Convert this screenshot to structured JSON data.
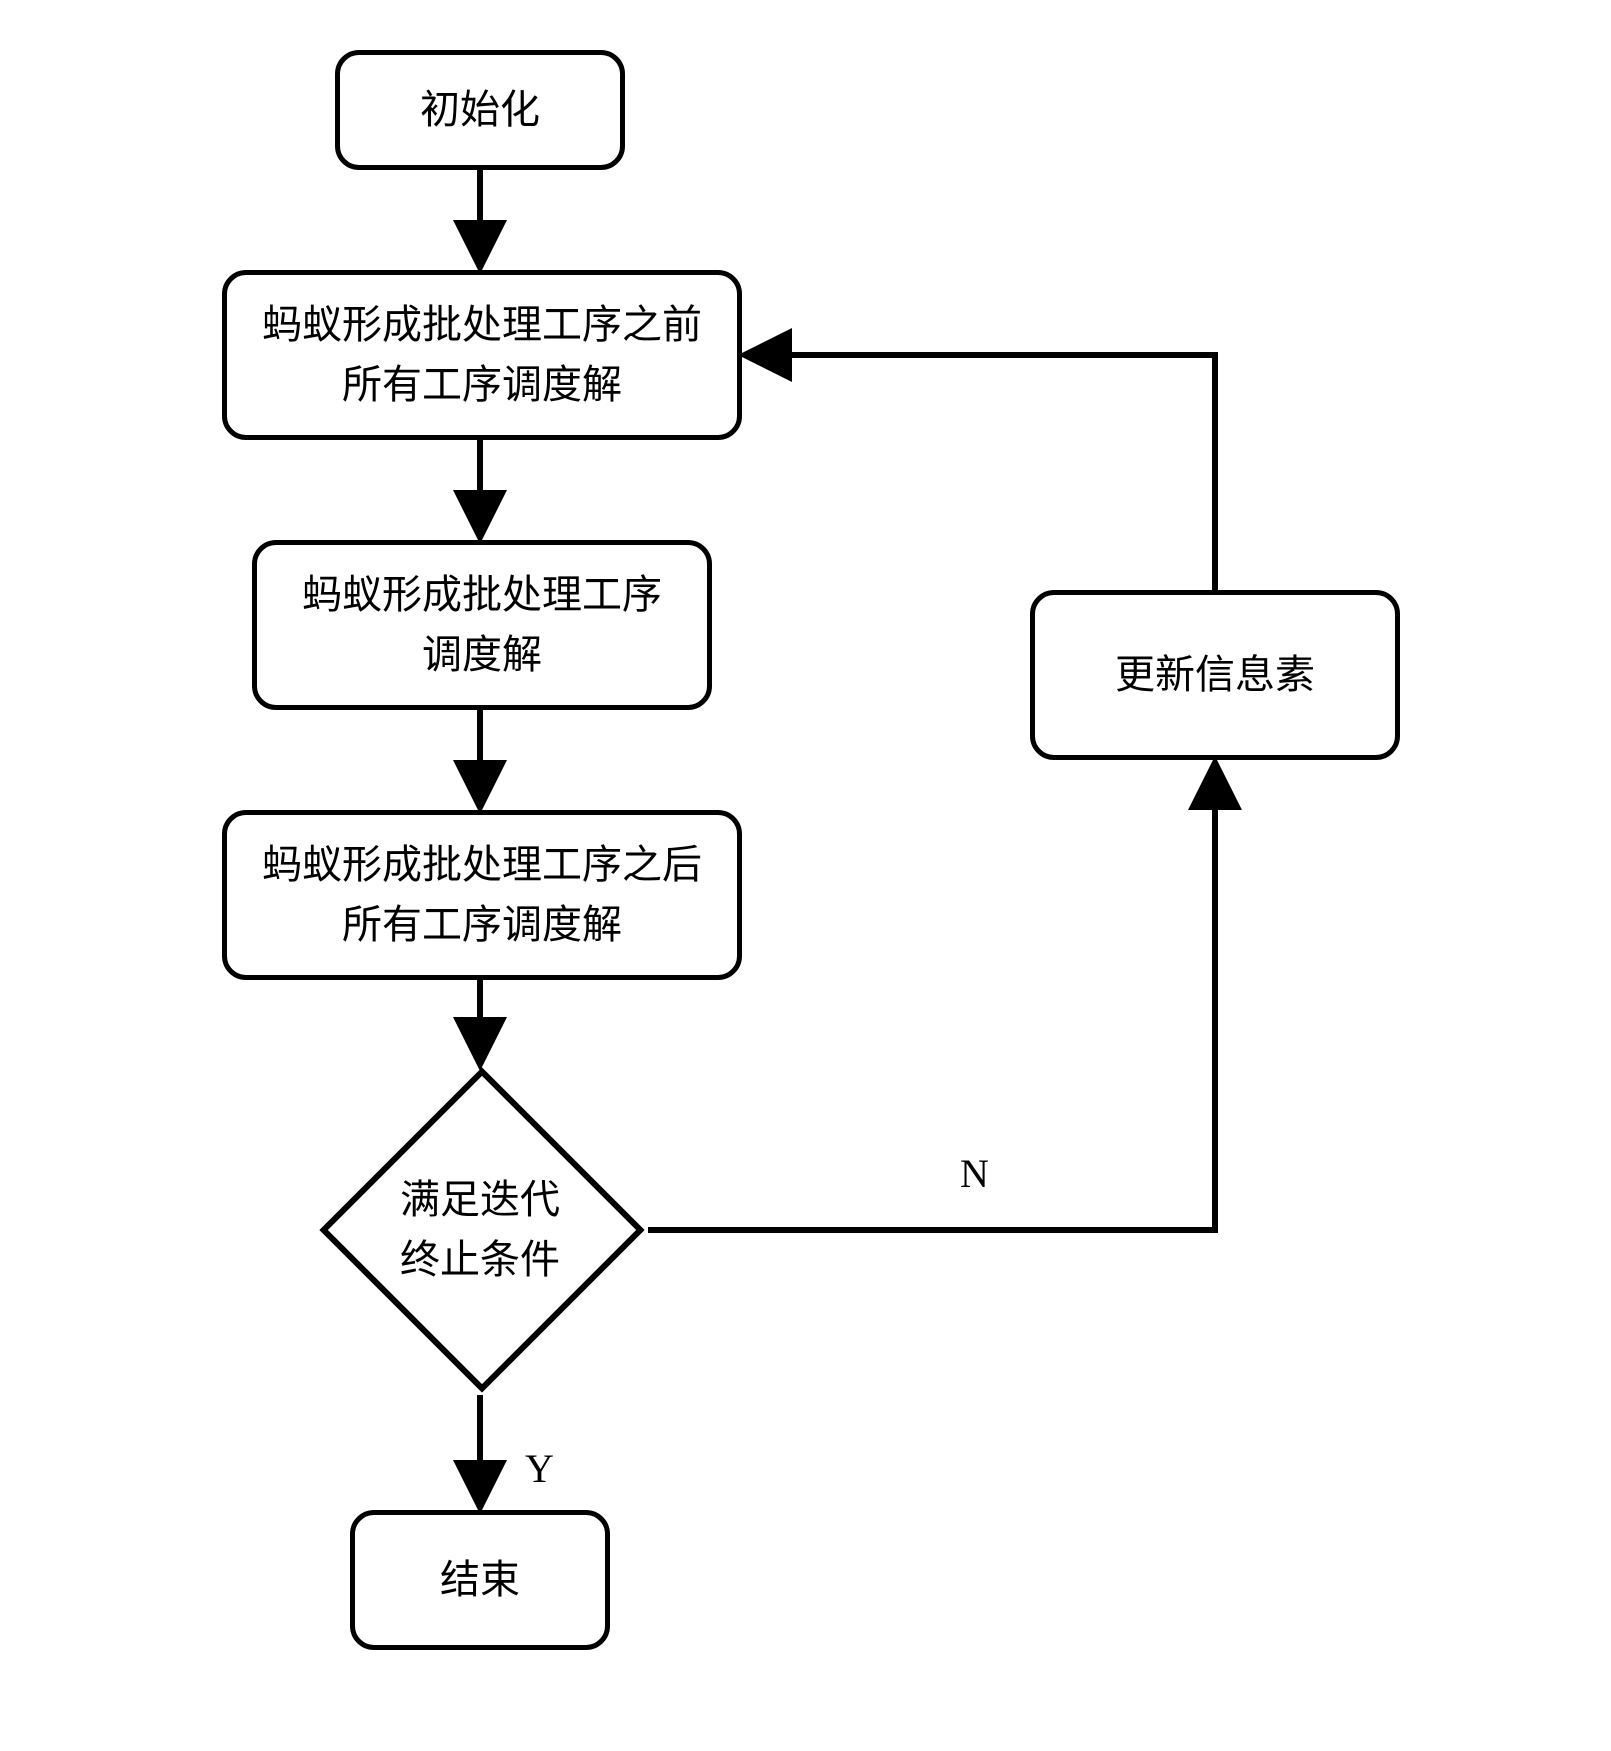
{
  "flowchart": {
    "nodes": {
      "init": {
        "label": "初始化"
      },
      "before": {
        "line1": "蚂蚁形成批处理工序之前",
        "line2": "所有工序调度解"
      },
      "batch": {
        "line1": "蚂蚁形成批处理工序",
        "line2": "调度解"
      },
      "after": {
        "line1": "蚂蚁形成批处理工序之后",
        "line2": "所有工序调度解"
      },
      "decision": {
        "line1": "满足迭代",
        "line2": "终止条件"
      },
      "update": {
        "label": "更新信息素"
      },
      "end": {
        "label": "结束"
      }
    },
    "edges": {
      "no": "N",
      "yes": "Y"
    }
  }
}
